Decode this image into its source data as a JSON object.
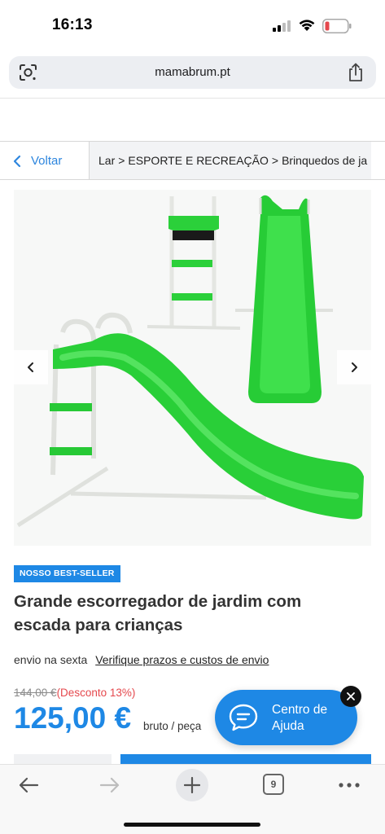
{
  "status_bar": {
    "time": "16:13",
    "icons": [
      "cellular-signal-icon",
      "wifi-icon",
      "battery-low-icon"
    ],
    "battery_color": "#e5484d"
  },
  "browser": {
    "url": "mamabrum.pt",
    "icons": [
      "google-lens-icon",
      "share-icon"
    ]
  },
  "breadcrumb": {
    "back_label": "Voltar",
    "items": [
      "Lar",
      "ESPORTE E RECREAÇÃO",
      "Brinquedos de ja"
    ],
    "separator": ">"
  },
  "gallery": {
    "image_subject": "green garden slide with ladder",
    "prev_icon": "chevron-left-icon",
    "next_icon": "chevron-right-icon",
    "slide_color": "#25d43a"
  },
  "product": {
    "badge": "NOSSO BEST-SELLER",
    "title": "Grande escorregador de jardim com escada para crianças",
    "shipping_text": "envio na sexta",
    "shipping_link": "Verifique prazos e custos de envio",
    "old_price": "144,00 €",
    "discount": "(Desconto 13%)",
    "price": "125,00 €",
    "price_unit": "bruto / peça"
  },
  "help_widget": {
    "label": "Centro de Ajuda",
    "icon": "chat-bubble-icon",
    "close_icon": "close-icon"
  },
  "toolbar": {
    "tab_count": "9",
    "icons": [
      "back-arrow-icon",
      "forward-arrow-icon",
      "plus-icon",
      "tabs-icon",
      "more-icon"
    ]
  },
  "colors": {
    "accent": "#1e88e5",
    "link": "#2e86de",
    "discount": "#e5484d"
  }
}
